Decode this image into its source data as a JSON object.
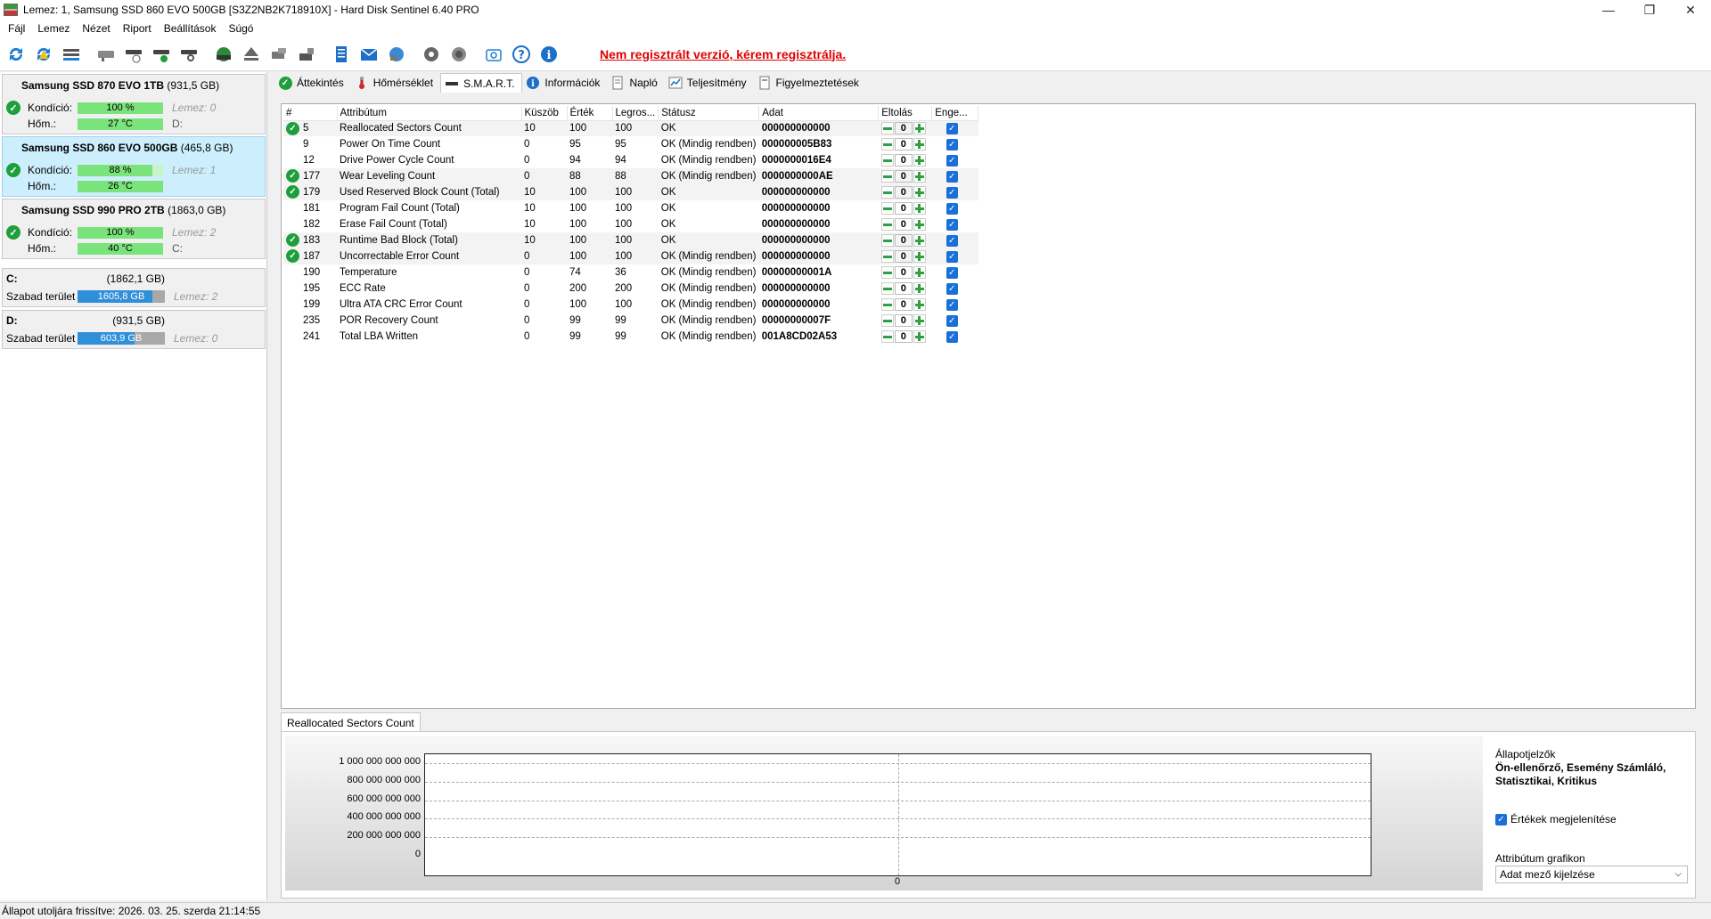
{
  "window": {
    "title": "Lemez: 1, Samsung SSD 860 EVO 500GB [S3Z2NB2K718910X]  -  Hard Disk Sentinel 6.40 PRO"
  },
  "menu": [
    "Fájl",
    "Lemez",
    "Nézet",
    "Riport",
    "Beállítások",
    "Súgó"
  ],
  "toolbar": {
    "register_notice": "Nem regisztrált verzió, kérem regisztrálja."
  },
  "disks": [
    {
      "name": "Samsung SSD 870 EVO 1TB",
      "size": "(931,5 GB)",
      "condition_label": "Kondíció:",
      "condition": "100 %",
      "condition_pct": 100,
      "disk_index": "Lemez: 0",
      "temp_label": "Hőm.:",
      "temp": "27 °C",
      "drive": "D:",
      "selected": false
    },
    {
      "name": "Samsung SSD 860 EVO 500GB",
      "size": "(465,8 GB)",
      "condition_label": "Kondíció:",
      "condition": "88 %",
      "condition_pct": 88,
      "disk_index": "Lemez: 1",
      "temp_label": "Hőm.:",
      "temp": "26 °C",
      "drive": "",
      "selected": true
    },
    {
      "name": "Samsung SSD 990 PRO 2TB",
      "size": "(1863,0 GB)",
      "condition_label": "Kondíció:",
      "condition": "100 %",
      "condition_pct": 100,
      "disk_index": "Lemez: 2",
      "temp_label": "Hőm.:",
      "temp": "40 °C",
      "drive": "C:",
      "selected": false
    }
  ],
  "volumes": [
    {
      "name": "C:",
      "size": "(1862,1 GB)",
      "free_label": "Szabad terület",
      "free": "1605,8 GB",
      "free_pct": 86,
      "disk": "Lemez: 2"
    },
    {
      "name": "D:",
      "size": "(931,5 GB)",
      "free_label": "Szabad terület",
      "free": "603,9 GB",
      "free_pct": 65,
      "disk": "Lemez: 0"
    }
  ],
  "tabs": [
    {
      "label": "Áttekintés",
      "icon": "check-icon"
    },
    {
      "label": "Hőmérséklet",
      "icon": "thermometer-icon"
    },
    {
      "label": "S.M.A.R.T.",
      "icon": "disk-icon",
      "active": true
    },
    {
      "label": "Információk",
      "icon": "info-icon"
    },
    {
      "label": "Napló",
      "icon": "document-icon"
    },
    {
      "label": "Teljesítmény",
      "icon": "chart-icon"
    },
    {
      "label": "Figyelmeztetések",
      "icon": "warning-icon"
    }
  ],
  "smart": {
    "columns": [
      "#",
      "Attribútum",
      "Küszöb",
      "Érték",
      "Legros...",
      "Státusz",
      "Adat",
      "Eltolás",
      "Enge..."
    ],
    "rows": [
      {
        "id": "5",
        "name": "Reallocated Sectors Count",
        "threshold": "10",
        "value": "100",
        "worst": "100",
        "status": "OK",
        "data": "000000000000",
        "offset": "0",
        "ok": true
      },
      {
        "id": "9",
        "name": "Power On Time Count",
        "threshold": "0",
        "value": "95",
        "worst": "95",
        "status": "OK (Mindig rendben)",
        "data": "000000005B83",
        "offset": "0",
        "ok": false
      },
      {
        "id": "12",
        "name": "Drive Power Cycle Count",
        "threshold": "0",
        "value": "94",
        "worst": "94",
        "status": "OK (Mindig rendben)",
        "data": "0000000016E4",
        "offset": "0",
        "ok": false
      },
      {
        "id": "177",
        "name": "Wear Leveling Count",
        "threshold": "0",
        "value": "88",
        "worst": "88",
        "status": "OK (Mindig rendben)",
        "data": "0000000000AE",
        "offset": "0",
        "ok": true
      },
      {
        "id": "179",
        "name": "Used Reserved Block Count (Total)",
        "threshold": "10",
        "value": "100",
        "worst": "100",
        "status": "OK",
        "data": "000000000000",
        "offset": "0",
        "ok": true
      },
      {
        "id": "181",
        "name": "Program Fail Count (Total)",
        "threshold": "10",
        "value": "100",
        "worst": "100",
        "status": "OK",
        "data": "000000000000",
        "offset": "0",
        "ok": false
      },
      {
        "id": "182",
        "name": "Erase Fail Count (Total)",
        "threshold": "10",
        "value": "100",
        "worst": "100",
        "status": "OK",
        "data": "000000000000",
        "offset": "0",
        "ok": false
      },
      {
        "id": "183",
        "name": "Runtime Bad Block (Total)",
        "threshold": "10",
        "value": "100",
        "worst": "100",
        "status": "OK",
        "data": "000000000000",
        "offset": "0",
        "ok": true
      },
      {
        "id": "187",
        "name": "Uncorrectable Error Count",
        "threshold": "0",
        "value": "100",
        "worst": "100",
        "status": "OK (Mindig rendben)",
        "data": "000000000000",
        "offset": "0",
        "ok": true
      },
      {
        "id": "190",
        "name": "Temperature",
        "threshold": "0",
        "value": "74",
        "worst": "36",
        "status": "OK (Mindig rendben)",
        "data": "00000000001A",
        "offset": "0",
        "ok": false
      },
      {
        "id": "195",
        "name": "ECC Rate",
        "threshold": "0",
        "value": "200",
        "worst": "200",
        "status": "OK (Mindig rendben)",
        "data": "000000000000",
        "offset": "0",
        "ok": false
      },
      {
        "id": "199",
        "name": "Ultra ATA CRC Error Count",
        "threshold": "0",
        "value": "100",
        "worst": "100",
        "status": "OK (Mindig rendben)",
        "data": "000000000000",
        "offset": "0",
        "ok": false
      },
      {
        "id": "235",
        "name": "POR Recovery Count",
        "threshold": "0",
        "value": "99",
        "worst": "99",
        "status": "OK (Mindig rendben)",
        "data": "00000000007F",
        "offset": "0",
        "ok": false
      },
      {
        "id": "241",
        "name": "Total LBA Written",
        "threshold": "0",
        "value": "99",
        "worst": "99",
        "status": "OK (Mindig rendben)",
        "data": "001A8CD02A53",
        "offset": "0",
        "ok": false
      }
    ]
  },
  "graph": {
    "tab_label": "Reallocated Sectors Count",
    "indicators_label": "Állapotjelzők",
    "indicators_value": "Ön-ellenőrző, Esemény Számláló, Statisztikai, Kritikus",
    "show_values_label": "Értékek megjelenítése",
    "attr_graph_label": "Attribútum grafikon",
    "attr_graph_value": "Adat mező kijelzése"
  },
  "chart_data": {
    "type": "line",
    "yticks": [
      "1 000 000 000 000",
      "800 000 000 000",
      "600 000 000 000",
      "400 000 000 000",
      "200 000 000 000",
      "0"
    ],
    "ylim": [
      0,
      1000000000000
    ],
    "x_tick": "0",
    "grid": true
  },
  "status": {
    "text": "Állapot utoljára frissítve: 2026. 03. 25. szerda 21:14:55"
  }
}
